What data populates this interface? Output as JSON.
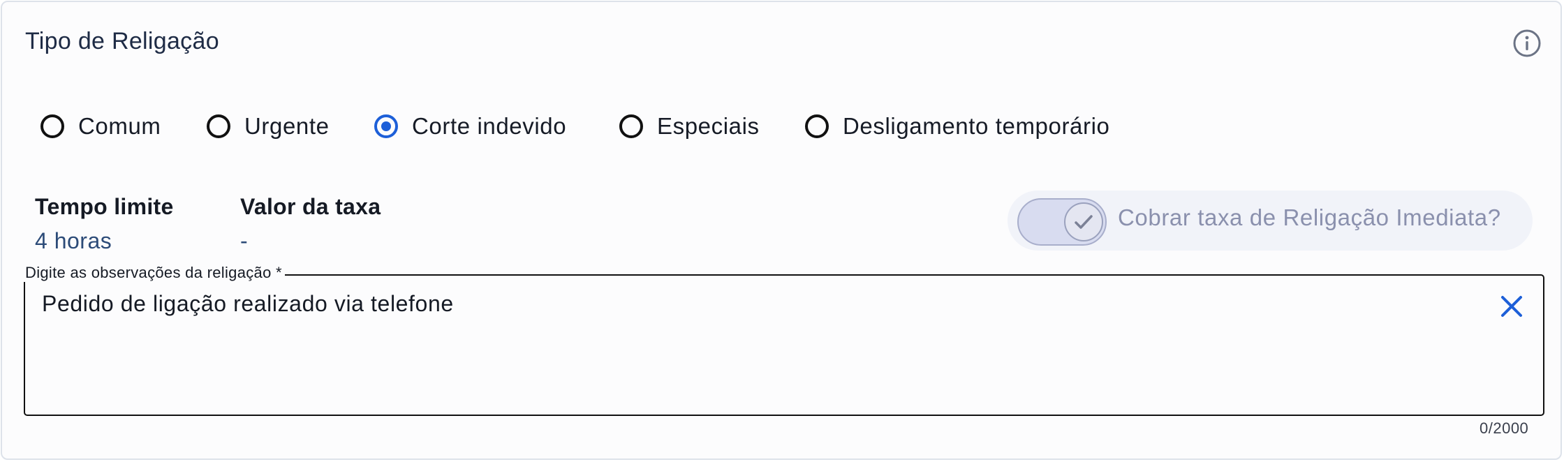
{
  "section": {
    "title": "Tipo de Religação",
    "info_icon": "info-circle-icon"
  },
  "radio_options": {
    "selected": "Corte indevido",
    "items": [
      {
        "label": "Comum",
        "checked": false
      },
      {
        "label": "Urgente",
        "checked": false
      },
      {
        "label": "Corte indevido",
        "checked": true
      },
      {
        "label": "Especiais",
        "checked": false
      },
      {
        "label": "Desligamento temporário",
        "checked": false
      }
    ]
  },
  "details": {
    "time_limit_label": "Tempo limite",
    "time_limit_value": "4 horas",
    "fee_label": "Valor da taxa",
    "fee_value": "-"
  },
  "toggle": {
    "label": "Cobrar taxa de Religação Imediata?",
    "checked": true,
    "disabled": true,
    "icon": "check-icon"
  },
  "observations": {
    "label": "Digite as observações da religação *",
    "value": "Pedido de ligação realizado via telefone",
    "clear_icon": "close-icon",
    "counter": "0/2000"
  },
  "colors": {
    "accent": "#1d5fd8",
    "value_text": "#2c4b78",
    "disabled_text": "#8a90ad",
    "border": "#dde2ea"
  }
}
